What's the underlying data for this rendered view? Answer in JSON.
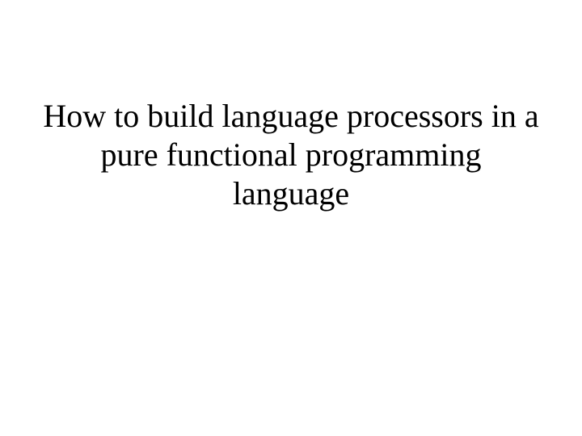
{
  "slide": {
    "title": "How to build language processors in a pure functional programming language"
  }
}
